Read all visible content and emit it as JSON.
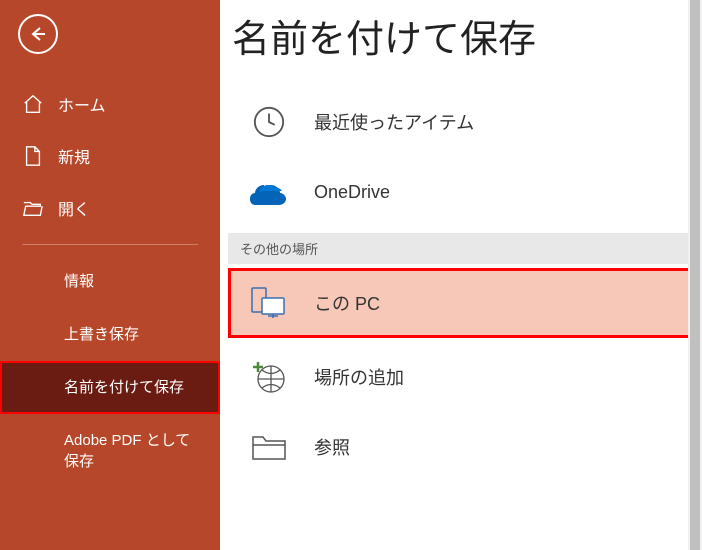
{
  "sidebar": {
    "back": "←",
    "home": "ホーム",
    "new": "新規",
    "open": "開く",
    "info": "情報",
    "save": "上書き保存",
    "saveas": "名前を付けて保存",
    "adobepdf": "Adobe PDF として保存"
  },
  "main": {
    "title": "名前を付けて保存",
    "recent": "最近使ったアイテム",
    "onedrive": "OneDrive",
    "other_header": "その他の場所",
    "thispc": "この PC",
    "addplace": "場所の追加",
    "browse": "参照"
  }
}
